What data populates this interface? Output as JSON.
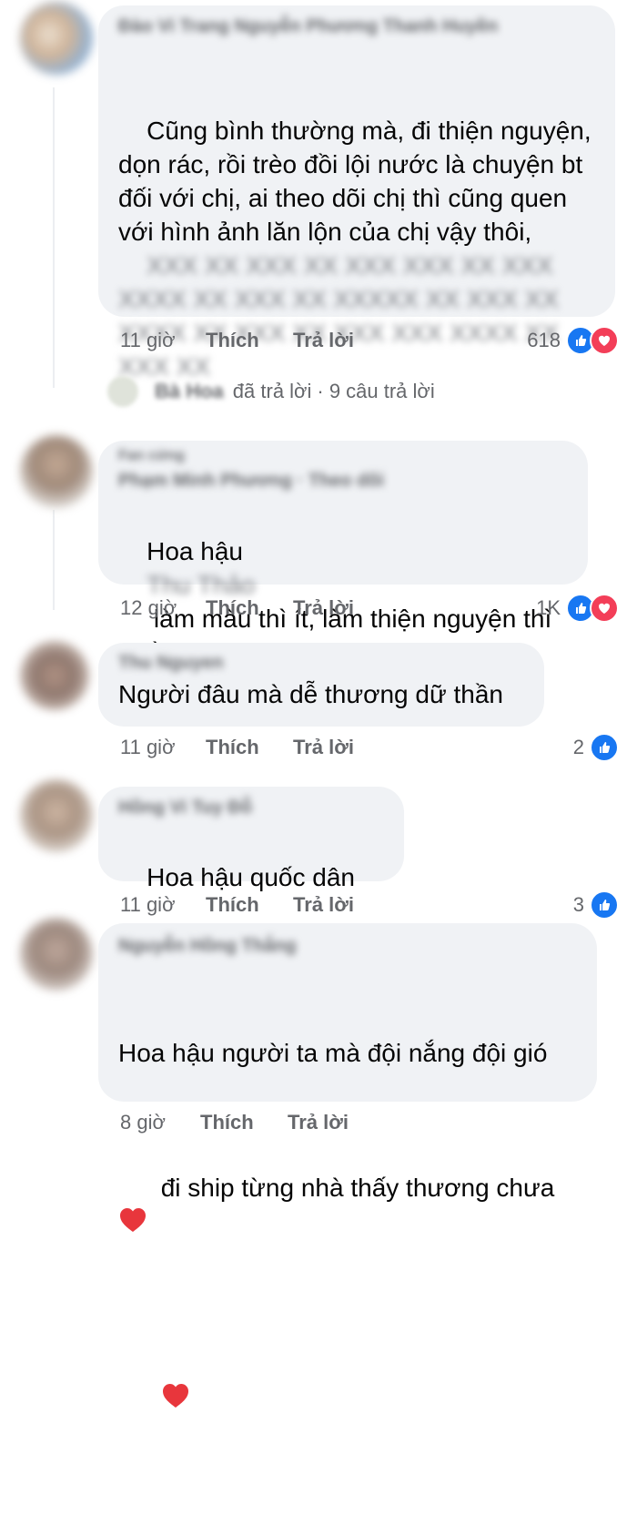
{
  "comments": [
    {
      "commenter_name": "Đào Vi Trang Nguyễn Phương Thanh Huyền",
      "text": "Cũng bình thường mà, đi thiện nguyện, dọn rác, rồi trèo đồi lội nước là chuyện bt đối với chị, ai theo dõi chị thì cũng quen với hình ảnh lăn lộn của chị vậy thôi,",
      "text_blurred": "XXX XX XXX XX XXX XXX XX XXX XXXX XX XXX XX XXXXX XX XXX XX XXXX XX XXX XX XXX XXX XXXX XX XXX XX",
      "time": "11 giờ",
      "like_label": "Thích",
      "reply_label": "Trả lời",
      "reaction_count": "618",
      "reactions": [
        "like",
        "love"
      ]
    },
    {
      "commenter_name": "Phạm Minh Phương · Theo dõi",
      "commenter_badge": "Fan cứng",
      "text_before": "Hoa hậu ",
      "text_blurred": "Thu Thảo",
      "text_after": " làm màu thì ít, làm thiện nguyện thì nhiều :)))",
      "time": "12 giờ",
      "like_label": "Thích",
      "reply_label": "Trả lời",
      "reaction_count": "1K",
      "reactions": [
        "like",
        "love"
      ]
    },
    {
      "commenter_name": "Thu Nguyen",
      "text": "Người đâu mà dễ thương dữ thần",
      "time": "11 giờ",
      "like_label": "Thích",
      "reply_label": "Trả lời",
      "reaction_count": "2",
      "reactions": [
        "like"
      ]
    },
    {
      "commenter_name": "Hồng Vi Tuy Đỗ",
      "text": "Hoa hậu quốc dân",
      "time": "11 giờ",
      "like_label": "Thích",
      "reply_label": "Trả lời",
      "reaction_count": "3",
      "reactions": [
        "like"
      ]
    },
    {
      "commenter_name": "Nguyễn Hồng Thắng",
      "text_line1": "Hoa hậu người ta mà đội nắng đội gió",
      "text_line2": "đi ship từng nhà thấy thương chưa",
      "time": "8 giờ",
      "like_label": "Thích",
      "reply_label": "Trả lời"
    }
  ],
  "replies_summary": {
    "replier_name": "Bà Hoa",
    "action": "đã trả lời",
    "count": "· 9 câu trả lời"
  },
  "colors": {
    "bubble": "#f0f2f5",
    "meta_text": "#65676b",
    "like_blue": "#1877f2",
    "love_red": "#f33e58",
    "heart_emoji": "#e8363c"
  }
}
